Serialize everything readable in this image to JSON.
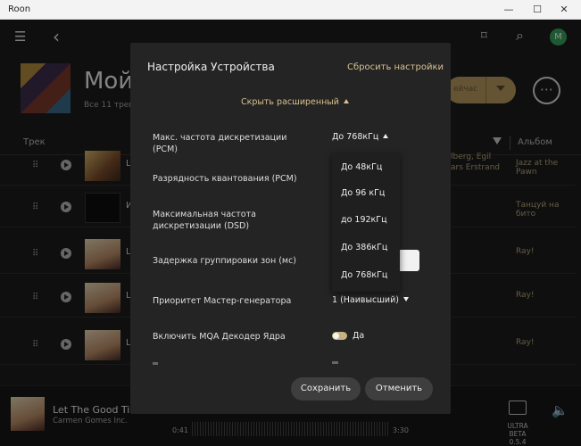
{
  "window": {
    "title": "Roon",
    "min": "—",
    "max": "☐",
    "close": "✕"
  },
  "topbar": {
    "menu_icon": "☰",
    "back_icon": "‹",
    "bookmark_icon": "⌑",
    "search_icon": "⌕",
    "avatar_letter": "M"
  },
  "header": {
    "title": "Мой",
    "subtitle": "Все 11 трек",
    "play_label": "ейчас",
    "more": "⋯"
  },
  "columns": {
    "track": "Трек",
    "album": "Альбом"
  },
  "tracks": [
    {
      "peek": "L",
      "album": "Jazz at the Pawn"
    },
    {
      "peek": "И",
      "album": "Танцуй на бито"
    },
    {
      "peek": "L",
      "album": "Ray!"
    },
    {
      "peek": "L",
      "album": "Ray!"
    },
    {
      "peek": "L",
      "album": "Ray!"
    }
  ],
  "artist_peek": {
    "line1": "lberg, Egil",
    "line2": "ars Erstrand"
  },
  "now_playing": {
    "title": "Let The Good Time",
    "artist": "Carmen Gomes Inc.",
    "elapsed": "0:41",
    "total": "3:30",
    "version_line1": "ULTRA BETA",
    "version_line2": "0.5.4"
  },
  "modal": {
    "title": "Настройка Устройства",
    "reset": "Сбросить настройки",
    "advanced_toggle": "Скрыть расширенный",
    "settings": [
      {
        "label": "Макс. частота дискретизации (PCM)",
        "value": "До 768кГц"
      },
      {
        "label": "Разрядность квантования (PCM)",
        "value": ""
      },
      {
        "label": "Максимальная частота дискретизации (DSD)",
        "value": ""
      },
      {
        "label": "Задержка группировки зон (мс)",
        "value": ""
      },
      {
        "label": "Приоритет Мастер-генератора",
        "value": "1 (Наивысший)"
      },
      {
        "label": "Включить MQA Декодер Ядра",
        "value": "Да"
      }
    ],
    "dropdown_options": [
      "До 48кГц",
      "До 96 кГц",
      "до 192кГц",
      "До 386кГц",
      "До 768кГц"
    ],
    "save": "Сохранить",
    "cancel": "Отменить"
  },
  "colors": {
    "accent": "#d8c28f",
    "bg": "#1d1d1d",
    "modal_bg": "#242424"
  }
}
